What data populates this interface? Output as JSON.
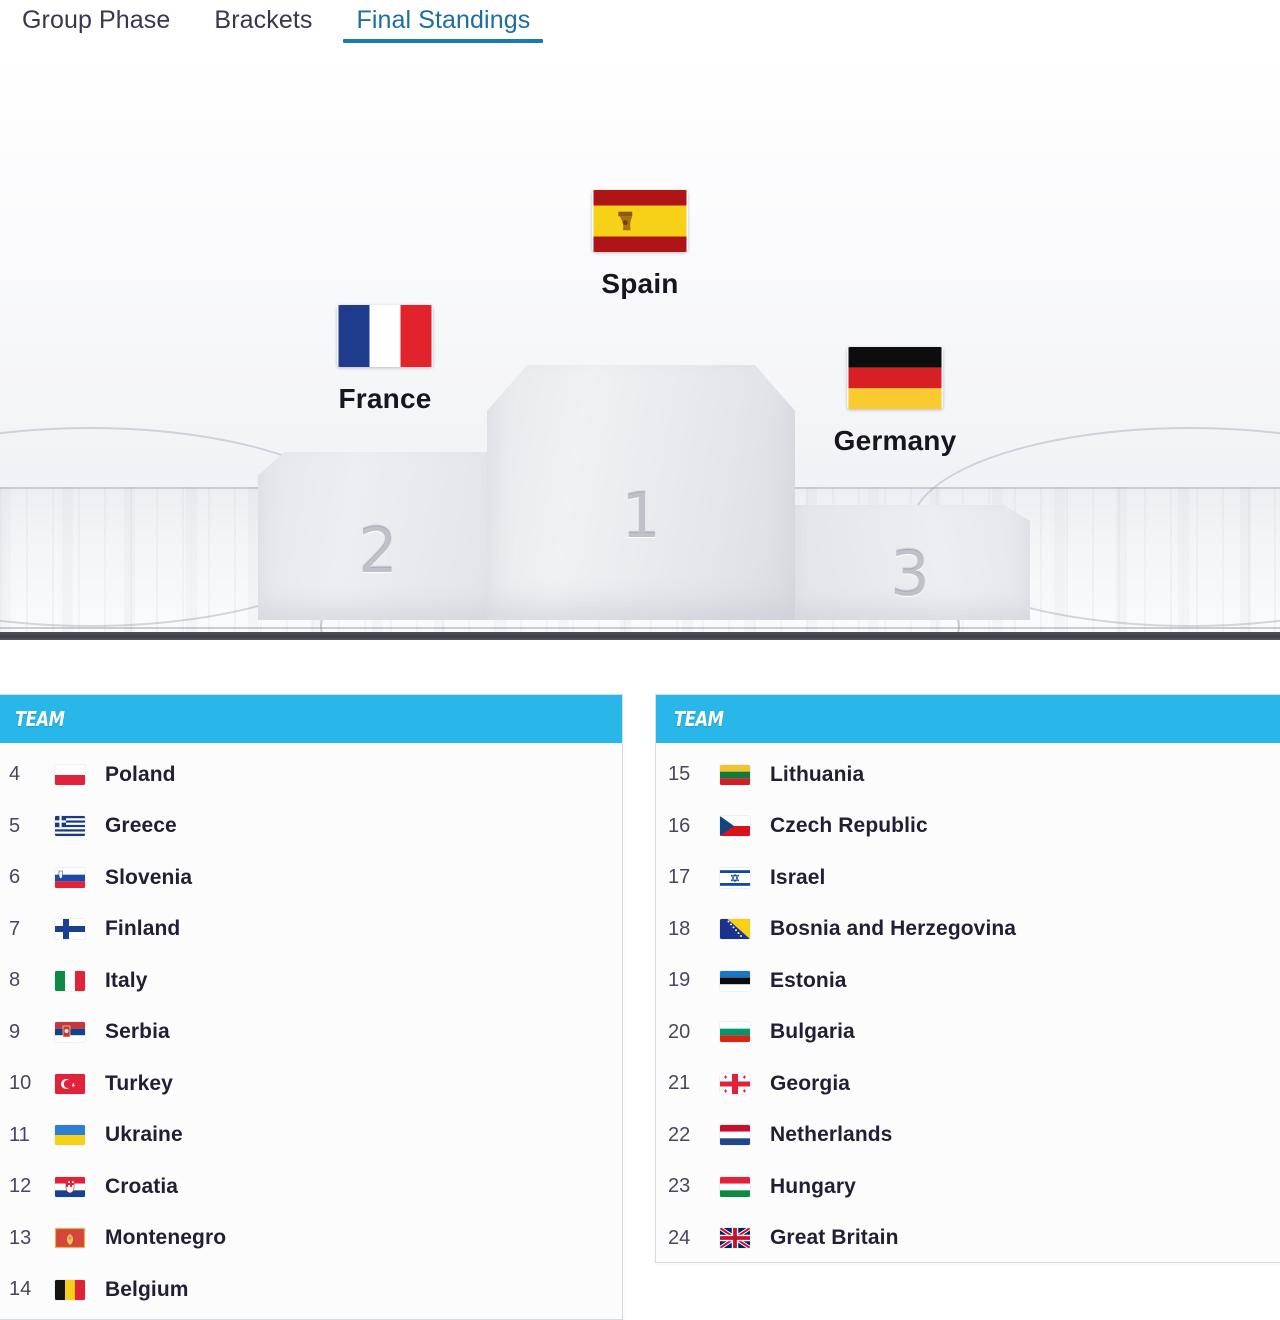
{
  "tabs": [
    {
      "label": "Group Phase",
      "active": false
    },
    {
      "label": "Brackets",
      "active": false
    },
    {
      "label": "Final Standings",
      "active": true
    }
  ],
  "podium": {
    "places": [
      {
        "position": "1",
        "number_label": "1",
        "team": "Spain",
        "flag": "flag-spain"
      },
      {
        "position": "2",
        "number_label": "2",
        "team": "France",
        "flag": "flag-france"
      },
      {
        "position": "3",
        "number_label": "3",
        "team": "Germany",
        "flag": "flag-germany"
      }
    ]
  },
  "colors": {
    "tab_active": "#1c6f9c",
    "tab_underline": "#1a7ba8",
    "table_header": "#29b6e8",
    "text_dark": "#221f33"
  },
  "tables": {
    "left": {
      "header": "TEAM",
      "rows": [
        {
          "rank": "4",
          "team": "Poland",
          "flag": "flag-poland"
        },
        {
          "rank": "5",
          "team": "Greece",
          "flag": "flag-greece"
        },
        {
          "rank": "6",
          "team": "Slovenia",
          "flag": "flag-slovenia"
        },
        {
          "rank": "7",
          "team": "Finland",
          "flag": "flag-finland"
        },
        {
          "rank": "8",
          "team": "Italy",
          "flag": "flag-italy"
        },
        {
          "rank": "9",
          "team": "Serbia",
          "flag": "flag-serbia"
        },
        {
          "rank": "10",
          "team": "Turkey",
          "flag": "flag-turkey"
        },
        {
          "rank": "11",
          "team": "Ukraine",
          "flag": "flag-ukraine"
        },
        {
          "rank": "12",
          "team": "Croatia",
          "flag": "flag-croatia"
        },
        {
          "rank": "13",
          "team": "Montenegro",
          "flag": "flag-montenegro"
        },
        {
          "rank": "14",
          "team": "Belgium",
          "flag": "flag-belgium"
        }
      ]
    },
    "right": {
      "header": "TEAM",
      "rows": [
        {
          "rank": "15",
          "team": "Lithuania",
          "flag": "flag-lithuania"
        },
        {
          "rank": "16",
          "team": "Czech Republic",
          "flag": "flag-czech-republic"
        },
        {
          "rank": "17",
          "team": "Israel",
          "flag": "flag-israel"
        },
        {
          "rank": "18",
          "team": "Bosnia and Herzegovina",
          "flag": "flag-bosnia"
        },
        {
          "rank": "19",
          "team": "Estonia",
          "flag": "flag-estonia"
        },
        {
          "rank": "20",
          "team": "Bulgaria",
          "flag": "flag-bulgaria"
        },
        {
          "rank": "21",
          "team": "Georgia",
          "flag": "flag-georgia"
        },
        {
          "rank": "22",
          "team": "Netherlands",
          "flag": "flag-netherlands"
        },
        {
          "rank": "23",
          "team": "Hungary",
          "flag": "flag-hungary"
        },
        {
          "rank": "24",
          "team": "Great Britain",
          "flag": "flag-great-britain"
        }
      ]
    }
  }
}
